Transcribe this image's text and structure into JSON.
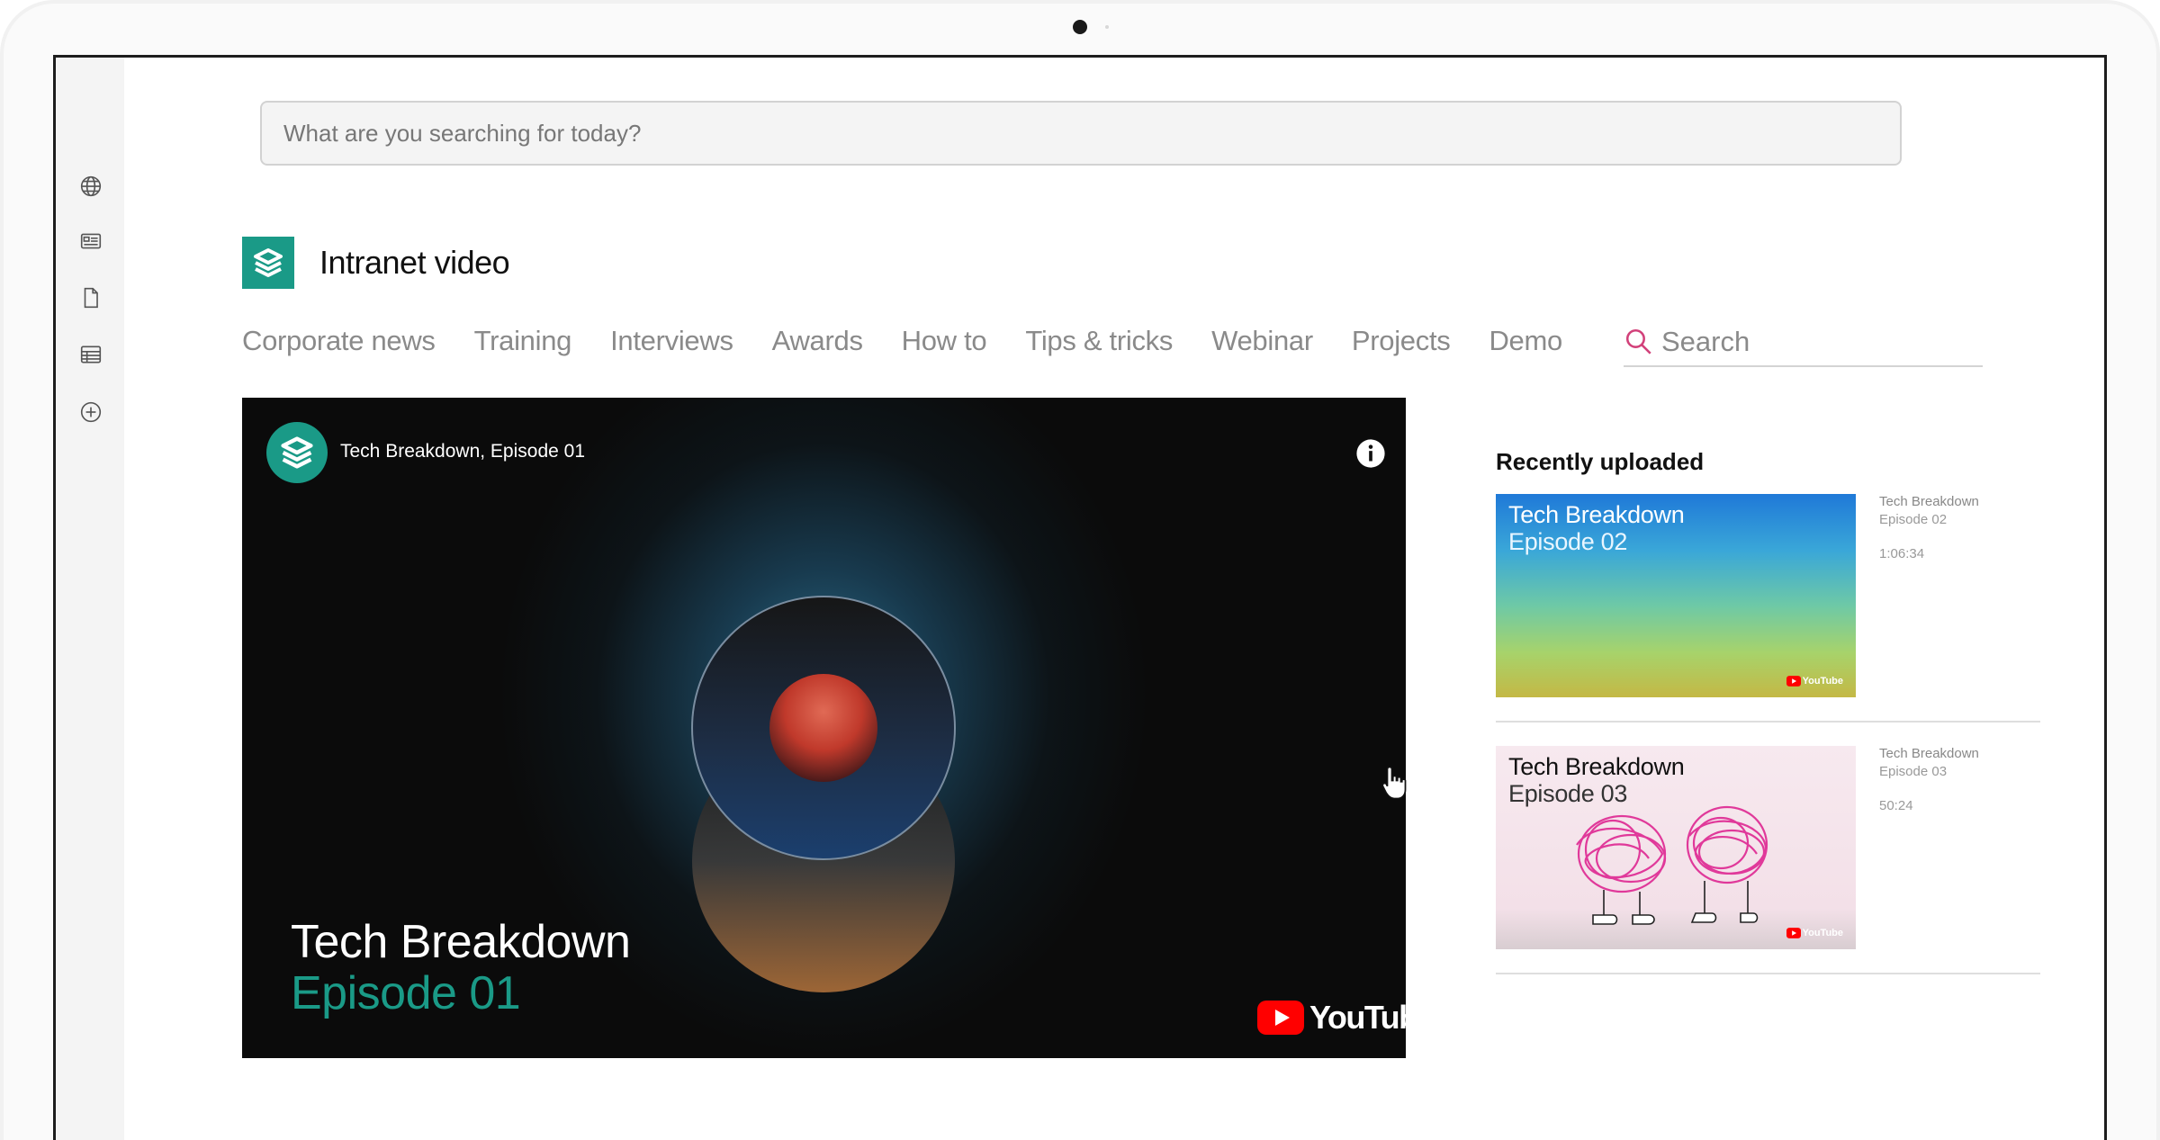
{
  "search": {
    "placeholder": "What are you searching for today?"
  },
  "rail": {
    "icons": [
      "globe-icon",
      "news-icon",
      "document-icon",
      "table-icon",
      "add-circle-icon"
    ]
  },
  "brand": {
    "title": "Intranet video",
    "logo_color": "#1a9a87"
  },
  "nav": {
    "items": [
      "Corporate news",
      "Training",
      "Interviews",
      "Awards",
      "How to",
      "Tips & tricks",
      "Webinar",
      "Projects",
      "Demo"
    ],
    "search_label": "Search",
    "search_icon_color": "#d2417a"
  },
  "player": {
    "channel_title": "Tech Breakdown, Episode 01",
    "episode_title": "Tech Breakdown",
    "episode_subtitle": "Episode 01",
    "brand_label": "YouTube",
    "accent_color": "#1a9a87"
  },
  "recent": {
    "heading": "Recently uploaded",
    "items": [
      {
        "thumb_title": "Tech Breakdown",
        "thumb_subtitle": "Episode 02",
        "meta_title": "Tech Breakdown",
        "meta_episode": "Episode 02",
        "duration": "1:06:34",
        "yt_label": "YouTube"
      },
      {
        "thumb_title": "Tech Breakdown",
        "thumb_subtitle": "Episode 03",
        "meta_title": "Tech Breakdown",
        "meta_episode": "Episode 03",
        "duration": "50:24",
        "yt_label": "YouTube"
      }
    ]
  }
}
